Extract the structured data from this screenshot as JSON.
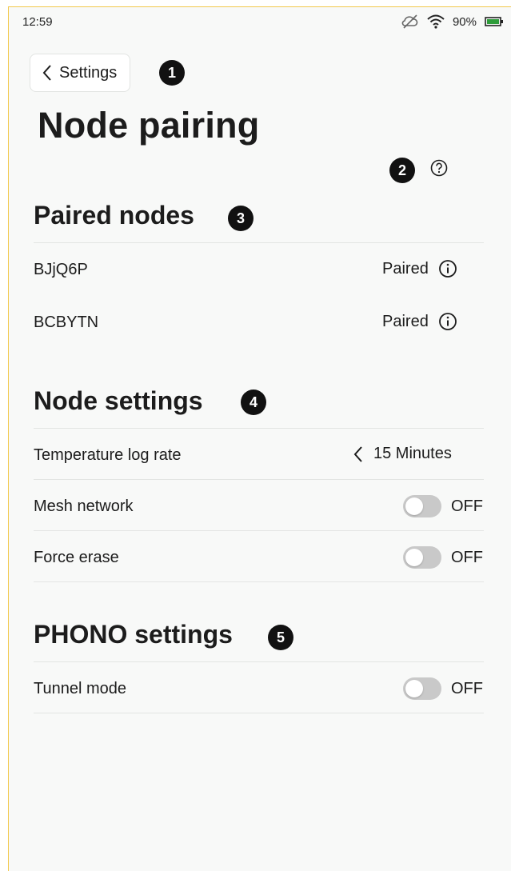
{
  "status_bar": {
    "time": "12:59",
    "battery": "90%",
    "icons": [
      "sync-off-icon",
      "wifi-icon",
      "battery-icon"
    ]
  },
  "back_button": {
    "label": "Settings",
    "icon": "chevron-left-icon"
  },
  "page_title": "Node pairing",
  "badges": [
    "1",
    "2",
    "3",
    "4",
    "5"
  ],
  "help_icon": "help-circle-icon",
  "paired_nodes": {
    "title": "Paired nodes",
    "items": [
      {
        "name": "BJjQ6P",
        "status": "Paired",
        "icon": "info-icon"
      },
      {
        "name": "BCBYTN",
        "status": "Paired",
        "icon": "info-icon"
      }
    ]
  },
  "node_settings": {
    "title": "Node settings",
    "temperature_log_rate": {
      "label": "Temperature log rate",
      "value": "15 Minutes",
      "icon": "chevron-left-icon"
    },
    "mesh_network": {
      "label": "Mesh network",
      "state": "OFF"
    },
    "force_erase": {
      "label": "Force erase",
      "state": "OFF"
    }
  },
  "phono_settings": {
    "title": "PHONO settings",
    "tunnel_mode": {
      "label": "Tunnel mode",
      "state": "OFF"
    }
  },
  "colors": {
    "background": "#f8f9f8",
    "badge": "#111111",
    "toggle_off": "#c9c9c9",
    "battery": "#2e9c3a",
    "frame_accent": "#f2c94c"
  }
}
